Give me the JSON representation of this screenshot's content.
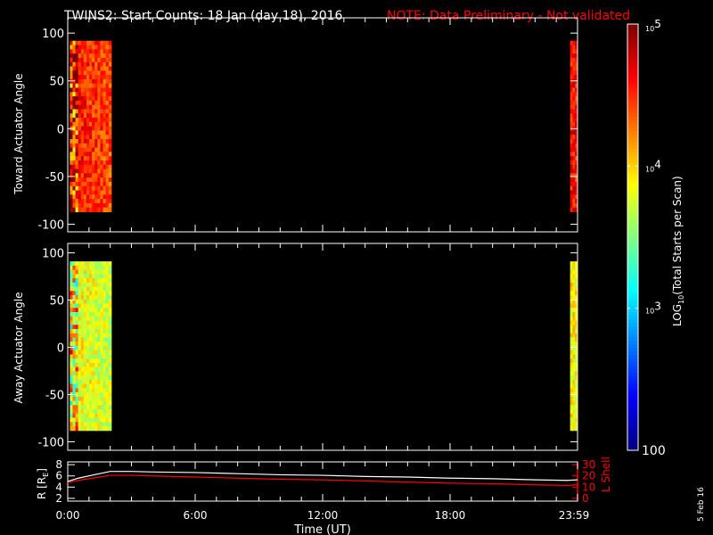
{
  "title": "TWINS2: Start Counts: 18 Jan (day  18), 2016",
  "note": "NOTE: Data Preliminary - Not validated",
  "colors": {
    "note": "#ff0000",
    "axis": "#ffffff",
    "lshell": "#ff0000",
    "rline": "#ffffff"
  },
  "stamp": "5 Feb 16",
  "chart_data": [
    {
      "type": "heatmap",
      "name": "toward",
      "ylabel": "Toward Actuator Angle",
      "ylim": [
        -108,
        116
      ],
      "yticks": [
        "100",
        "50",
        "0",
        "-50",
        "-100"
      ],
      "ytick_values": [
        100,
        50,
        0,
        -50,
        -100
      ],
      "xlim": [
        0,
        24
      ],
      "data_intervals_hours": [
        [
          0.1,
          2.05
        ],
        [
          23.65,
          24
        ]
      ],
      "angle_range": [
        -87,
        92
      ],
      "typical_log10_counts": 4.6
    },
    {
      "type": "heatmap",
      "name": "away",
      "ylabel": "Away Actuator Angle",
      "ylim": [
        -109,
        110
      ],
      "yticks": [
        "100",
        "50",
        "0",
        "-50",
        "-100"
      ],
      "ytick_values": [
        100,
        50,
        0,
        -50,
        -100
      ],
      "xlim": [
        0,
        24
      ],
      "data_intervals_hours": [
        [
          0.1,
          2.05
        ],
        [
          23.65,
          24
        ]
      ],
      "angle_range": [
        -88,
        91
      ],
      "typical_log10_counts": 3.9
    },
    {
      "type": "line",
      "name": "ephemeris",
      "xlabel": "Time (UT)",
      "xticks": [
        "0:00",
        "6:00",
        "12:00",
        "18:00",
        "23:59"
      ],
      "xtick_values": [
        0,
        6,
        12,
        18,
        24
      ],
      "ylabel_left": "R [R",
      "ylabel_left_sub": "E",
      "ylabel_left_end": "]",
      "yticks_left": [
        "8",
        "6",
        "4",
        "2"
      ],
      "ylim_left": [
        1.5,
        8.5
      ],
      "ylabel_right": "L Shell",
      "yticks_right": [
        "30",
        "20",
        "10",
        "0"
      ],
      "ylim_right": [
        -2.5,
        32.5
      ],
      "series": [
        {
          "name": "R",
          "x": [
            0,
            0.5,
            1,
            1.5,
            2,
            3,
            4,
            6,
            8,
            10,
            12,
            14,
            16,
            18,
            20,
            22,
            23.5,
            24
          ],
          "values": [
            5.0,
            5.6,
            6.0,
            6.4,
            6.8,
            6.8,
            6.7,
            6.6,
            6.4,
            6.2,
            6.1,
            5.9,
            5.8,
            5.6,
            5.5,
            5.3,
            5.2,
            5.3
          ]
        },
        {
          "name": "L Shell",
          "x": [
            0,
            0.5,
            1,
            1.5,
            2,
            3,
            4,
            6,
            8,
            10,
            12,
            14,
            16,
            18,
            20,
            22,
            23.5,
            24
          ],
          "values": [
            14,
            16,
            17.5,
            19,
            20.5,
            20.5,
            20,
            19,
            18,
            17,
            16.5,
            15.5,
            14.5,
            13.5,
            13,
            12,
            11.5,
            12
          ]
        }
      ]
    },
    {
      "type": "colorbar",
      "label": "LOG",
      "label_sub": "10",
      "label_rest": "(Total Starts per Scan)",
      "ticks": [
        {
          "base": "10",
          "exp": "5",
          "value": 5
        },
        {
          "base": "10",
          "exp": "4",
          "value": 4
        },
        {
          "base": "10",
          "exp": "3",
          "value": 3
        }
      ],
      "min_label": "100",
      "range_log10": [
        2,
        5
      ]
    }
  ]
}
